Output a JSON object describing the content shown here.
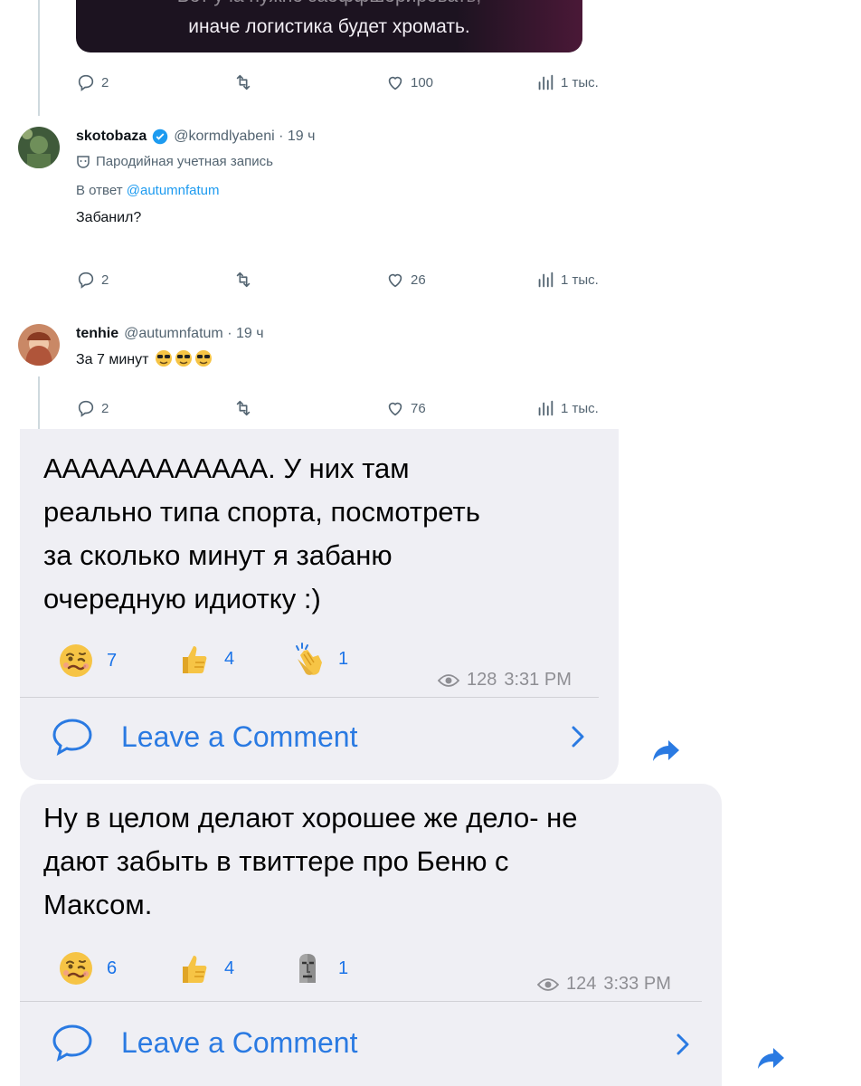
{
  "top_tweet": {
    "image_caption_partial": "Вот уча нужно заоффшорировать,",
    "image_caption": "иначе логистика будет хромать.",
    "stats": {
      "replies": "2",
      "likes": "100",
      "views": "1 тыс."
    }
  },
  "tweets": [
    {
      "name": "skotobaza",
      "handle": "@kormdlyabeni · 19 ч",
      "parody_label": "Пародийная учетная запись",
      "reply_prefix": "В ответ",
      "reply_mention": "@autumnfatum",
      "text": "Забанил?",
      "stats": {
        "replies": "2",
        "likes": "26",
        "views": "1 тыс."
      }
    },
    {
      "name": "tenhie",
      "handle": "@autumnfatum · 19 ч",
      "text": "За 7 минут",
      "stats": {
        "replies": "2",
        "likes": "76",
        "views": "1 тыс."
      }
    }
  ],
  "messages": [
    {
      "lines": [
        "АААААААААААА. У них там",
        "реально типа спорта, посмотреть",
        "за сколько минут я забаню",
        "очередную идиотку :)"
      ],
      "reactions": [
        {
          "icon": "woozy-face-icon",
          "count": "7"
        },
        {
          "icon": "thumbs-up-icon",
          "count": "4"
        },
        {
          "icon": "clapping-hands-icon",
          "count": "1"
        }
      ],
      "views": "128",
      "time": "3:31 PM",
      "comment_label": "Leave a Comment"
    },
    {
      "lines": [
        "Ну в целом делают хорошее же дело- не",
        "дают забыть в твиттере про Беню с",
        "Максом."
      ],
      "reactions": [
        {
          "icon": "woozy-face-icon",
          "count": "6"
        },
        {
          "icon": "thumbs-up-icon",
          "count": "4"
        },
        {
          "icon": "moai-icon",
          "count": "1"
        }
      ],
      "views": "124",
      "time": "3:33 PM",
      "comment_label": "Leave a Comment"
    }
  ],
  "colors": {
    "accent": "#2a7ae2",
    "twitter_blue": "#1d9bf0",
    "bubble": "#efeff4"
  }
}
